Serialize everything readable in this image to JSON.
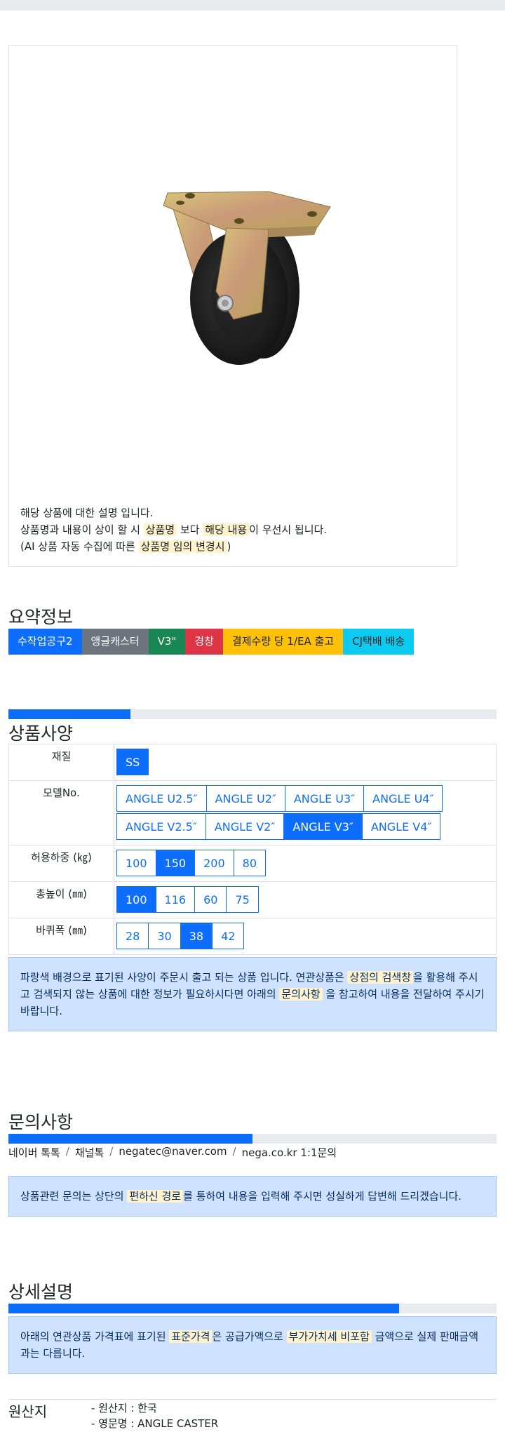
{
  "image_description": {
    "line1": "해당 상품에 대한 설명 입니다.",
    "line2_a": "상품명과 내용이 상이 할 시 ",
    "line2_hl1": "상품명",
    "line2_b": " 보다 ",
    "line2_hl2": "해당 내용",
    "line2_c": "이 우선시 됩니다.",
    "line3_a": "(AI 상품 자동 수집에 따른 ",
    "line3_hl": "상품명 임의 변경시",
    "line3_b": ")"
  },
  "summary": {
    "title": "요약정보",
    "badges": [
      {
        "label": "수작업공구2",
        "color": "#0d6efd",
        "text_color": "#ffffff"
      },
      {
        "label": "앵글캐스터",
        "color": "#6c757d",
        "text_color": "#ffffff"
      },
      {
        "label": "V3\"",
        "color": "#198754",
        "text_color": "#ffffff"
      },
      {
        "label": "경창",
        "color": "#dc3545",
        "text_color": "#ffffff"
      },
      {
        "label": "결제수량 당 1/EA 출고",
        "color": "#ffc107",
        "text_color": "#212529"
      },
      {
        "label": "CJ택배 배송",
        "color": "#0dcaf0",
        "text_color": "#212529"
      }
    ]
  },
  "spec": {
    "title": "상품사양",
    "progress_percent": 25,
    "rows": [
      {
        "label": "재질",
        "option_rows": [
          [
            {
              "label": "SS",
              "active": true
            }
          ]
        ]
      },
      {
        "label": "모델No.",
        "option_rows": [
          [
            {
              "label": "ANGLE U2.5″",
              "active": false
            },
            {
              "label": "ANGLE U2″",
              "active": false
            },
            {
              "label": "ANGLE U3″",
              "active": false
            },
            {
              "label": "ANGLE U4″",
              "active": false
            }
          ],
          [
            {
              "label": "ANGLE V2.5″",
              "active": false
            },
            {
              "label": "ANGLE V2″",
              "active": false
            },
            {
              "label": "ANGLE V3″",
              "active": true
            },
            {
              "label": "ANGLE V4″",
              "active": false
            }
          ]
        ]
      },
      {
        "label": "허용하중 (㎏)",
        "option_rows": [
          [
            {
              "label": "100",
              "active": false
            },
            {
              "label": "150",
              "active": true
            },
            {
              "label": "200",
              "active": false
            },
            {
              "label": "80",
              "active": false
            }
          ]
        ]
      },
      {
        "label": "총높이 (㎜)",
        "option_rows": [
          [
            {
              "label": "100",
              "active": true
            },
            {
              "label": "116",
              "active": false
            },
            {
              "label": "60",
              "active": false
            },
            {
              "label": "75",
              "active": false
            }
          ]
        ]
      },
      {
        "label": "바퀴폭 (㎜)",
        "option_rows": [
          [
            {
              "label": "28",
              "active": false
            },
            {
              "label": "30",
              "active": false
            },
            {
              "label": "38",
              "active": true
            },
            {
              "label": "42",
              "active": false
            }
          ]
        ]
      }
    ],
    "notice_a": "파랑색 배경으로 표기된 사양이 주문시 출고 되는 상품 입니다. 연관상품은 ",
    "notice_hl1": "상점의 검색창",
    "notice_b": "을 활용해 주시고 검색되지 않는 상품에 대한 정보가 필요하시다면 아래의 ",
    "notice_hl2": "문의사항",
    "notice_c": " 을 참고하여 내용을 전달하여 주시기 바랍니다."
  },
  "inquiry": {
    "title": "문의사항",
    "progress_percent": 50,
    "contacts": [
      "네이버 톡톡",
      "채널톡",
      "negatec@naver.com",
      "nega.co.kr 1:1문의"
    ],
    "separator": "/",
    "notice_a": "상품관련 문의는 상단의 ",
    "notice_hl": "편하신 경로",
    "notice_b": "를 통하여 내용을 입력해 주시면 성실하게 답변해 드리겠습니다."
  },
  "detail": {
    "title": "상세설명",
    "progress_percent": 80,
    "notice_a": "아래의 연관상품 가격표에 표기된 ",
    "notice_hl1": "표준가격",
    "notice_b": "은 공급가액으로 ",
    "notice_hl2": "부가가치세 비포함",
    "notice_c": " 금액으로 실제 판매금액과는 다릅니다."
  },
  "origin": {
    "label": "원산지",
    "items": [
      "- 원산지 : 한국",
      "- 영문명 : ANGLE CASTER"
    ]
  }
}
